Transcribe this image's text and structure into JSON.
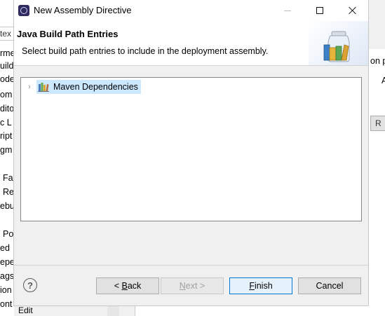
{
  "dialog": {
    "title": "New Assembly Directive",
    "header_title": "Java Build Path Entries",
    "header_description": "Select build path entries to include in the deployment assembly.",
    "tree": {
      "items": [
        {
          "label": "Maven Dependencies",
          "expanded": false,
          "selected": true,
          "icon": "library-icon"
        }
      ]
    },
    "buttons": {
      "back": {
        "prefix": "< ",
        "mnemonic": "B",
        "rest": "ack"
      },
      "next": {
        "prefix": "",
        "mnemonic": "N",
        "rest": "ext >"
      },
      "finish": {
        "prefix": "",
        "mnemonic": "F",
        "rest": "inish"
      },
      "cancel": {
        "label": "Cancel"
      }
    },
    "help_glyph": "?",
    "window_controls": [
      "minimize-icon",
      "maximize-icon",
      "close-icon"
    ]
  },
  "background": {
    "left_field_text": "tex",
    "left_lines": [
      "rme",
      "uild",
      "ode",
      "om",
      "dito",
      "c L",
      "ript",
      "gm",
      "Fa",
      "Re",
      "ebu",
      "Po",
      "ed",
      "epe",
      "ags",
      "ion",
      "ont"
    ],
    "right_texts": [
      "on p",
      "A"
    ],
    "right_buttons": [
      "R"
    ],
    "bottom_texts": [
      "Edit"
    ]
  },
  "colors": {
    "selection": "#cce8ff",
    "default_button_border": "#0078d7",
    "dialog_bg": "#f0f0f0"
  }
}
